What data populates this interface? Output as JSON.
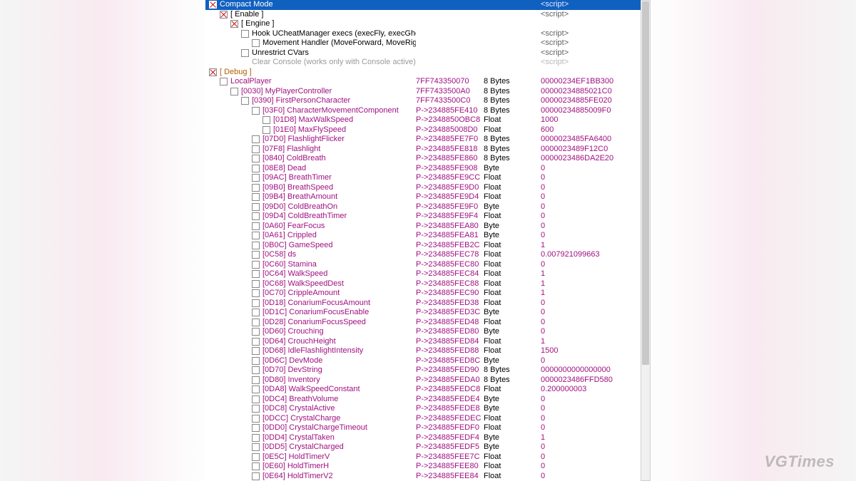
{
  "watermark": "VGTimes",
  "scriptTag": "<script>",
  "rows": [
    {
      "indent": 0,
      "checked": true,
      "header": true,
      "descClass": "",
      "label": "Compact Mode",
      "addr": "",
      "type": "",
      "val": "",
      "script": true
    },
    {
      "indent": 1,
      "checked": true,
      "descClass": "bracket",
      "label": "[ Enable ]",
      "addr": "",
      "type": "",
      "val": "",
      "script": true
    },
    {
      "indent": 2,
      "checked": true,
      "descClass": "bracket",
      "label": "[ Engine ]",
      "addr": "",
      "type": "",
      "val": ""
    },
    {
      "indent": 3,
      "checked": false,
      "descClass": "",
      "label": "Hook UCheatManager execs (execFly, execGhost, execWalk)",
      "addr": "",
      "type": "",
      "val": "",
      "script": true
    },
    {
      "indent": 4,
      "checked": false,
      "descClass": "",
      "label": "Movement Handler (MoveForward, MoveRight, MoveUp)",
      "addr": "",
      "type": "",
      "val": "",
      "script": true
    },
    {
      "indent": 3,
      "checked": false,
      "descClass": "",
      "label": "Unrestrict CVars",
      "addr": "",
      "type": "",
      "val": "",
      "script": true
    },
    {
      "indent": 3,
      "nobox": true,
      "descClass": "dim",
      "label": "Clear Console (works only with Console active)",
      "addr": "",
      "type": "",
      "val": "",
      "script": true,
      "scriptDim": true
    },
    {
      "indent": 0,
      "checked": true,
      "descClass": "debug",
      "label": "[ Debug ]",
      "addr": "",
      "type": "",
      "val": ""
    },
    {
      "indent": 1,
      "checked": false,
      "descClass": "purple",
      "label": "LocalPlayer",
      "addr": "7FF743350070",
      "type": "8 Bytes",
      "val": "00000234EF1BB300",
      "purple": true
    },
    {
      "indent": 2,
      "checked": false,
      "descClass": "purple",
      "label": "[0030] MyPlayerController",
      "addr": "7FF7433500A0",
      "type": "8 Bytes",
      "val": "00000234885021C0",
      "purple": true
    },
    {
      "indent": 3,
      "checked": false,
      "descClass": "purple",
      "label": "[0390] FirstPersonCharacter",
      "addr": "7FF7433500C0",
      "type": "8 Bytes",
      "val": "00000234885FE020",
      "purple": true
    },
    {
      "indent": 4,
      "checked": false,
      "descClass": "purple",
      "label": "[03F0] CharacterMovementComponent",
      "addr": "P->234885FE410",
      "type": "8 Bytes",
      "val": "00000234885009F0",
      "purple": true
    },
    {
      "indent": 5,
      "checked": false,
      "descClass": "purple",
      "label": "[01D8] MaxWalkSpeed",
      "addr": "P->2348850OBC8",
      "type": "Float",
      "val": "1000",
      "purple": true
    },
    {
      "indent": 5,
      "checked": false,
      "descClass": "purple",
      "label": "[01E0] MaxFlySpeed",
      "addr": "P->234885008D0",
      "type": "Float",
      "val": "600",
      "purple": true
    },
    {
      "indent": 4,
      "checked": false,
      "descClass": "purple",
      "label": "[07D0] FlashlightFlicker",
      "addr": "P->234885FE7F0",
      "type": "8 Bytes",
      "val": "0000023485FA6400",
      "purple": true
    },
    {
      "indent": 4,
      "checked": false,
      "descClass": "purple",
      "label": "[07F8] Flashlight",
      "addr": "P->234885FE818",
      "type": "8 Bytes",
      "val": "0000023489F12C0",
      "purple": true
    },
    {
      "indent": 4,
      "checked": false,
      "descClass": "purple",
      "label": "[0840] ColdBreath",
      "addr": "P->234885FE860",
      "type": "8 Bytes",
      "val": "0000023486DA2E20",
      "purple": true
    },
    {
      "indent": 4,
      "checked": false,
      "descClass": "purple",
      "label": "[08E8] Dead",
      "addr": "P->234885FE908",
      "type": "Byte",
      "val": "0",
      "purple": true
    },
    {
      "indent": 4,
      "checked": false,
      "descClass": "purple",
      "label": "[09AC] BreathTimer",
      "addr": "P->234885FE9CC",
      "type": "Float",
      "val": "0",
      "purple": true
    },
    {
      "indent": 4,
      "checked": false,
      "descClass": "purple",
      "label": "[09B0] BreathSpeed",
      "addr": "P->234885FE9D0",
      "type": "Float",
      "val": "0",
      "purple": true
    },
    {
      "indent": 4,
      "checked": false,
      "descClass": "purple",
      "label": "[09B4] BreathAmount",
      "addr": "P->234885FE9D4",
      "type": "Float",
      "val": "0",
      "purple": true
    },
    {
      "indent": 4,
      "checked": false,
      "descClass": "purple",
      "label": "[09D0] ColdBreathOn",
      "addr": "P->234885FE9F0",
      "type": "Byte",
      "val": "0",
      "purple": true
    },
    {
      "indent": 4,
      "checked": false,
      "descClass": "purple",
      "label": "[09D4] ColdBreathTimer",
      "addr": "P->234885FE9F4",
      "type": "Float",
      "val": "0",
      "purple": true
    },
    {
      "indent": 4,
      "checked": false,
      "descClass": "purple",
      "label": "[0A60] FearFocus",
      "addr": "P->234885FEA80",
      "type": "Byte",
      "val": "0",
      "purple": true
    },
    {
      "indent": 4,
      "checked": false,
      "descClass": "purple",
      "label": "[0A61] Crippled",
      "addr": "P->234885FEA81",
      "type": "Byte",
      "val": "0",
      "purple": true
    },
    {
      "indent": 4,
      "checked": false,
      "descClass": "purple",
      "label": "[0B0C] GameSpeed",
      "addr": "P->234885FEB2C",
      "type": "Float",
      "val": "1",
      "purple": true
    },
    {
      "indent": 4,
      "checked": false,
      "descClass": "purple",
      "label": "[0C58] ds",
      "addr": "P->234885FEC78",
      "type": "Float",
      "val": "0.007921099663",
      "purple": true
    },
    {
      "indent": 4,
      "checked": false,
      "descClass": "purple",
      "label": "[0C60] Stamina",
      "addr": "P->234885FEC80",
      "type": "Float",
      "val": "0",
      "purple": true
    },
    {
      "indent": 4,
      "checked": false,
      "descClass": "purple",
      "label": "[0C64] WalkSpeed",
      "addr": "P->234885FEC84",
      "type": "Float",
      "val": "1",
      "purple": true
    },
    {
      "indent": 4,
      "checked": false,
      "descClass": "purple",
      "label": "[0C68] WalkSpeedDest",
      "addr": "P->234885FEC88",
      "type": "Float",
      "val": "1",
      "purple": true
    },
    {
      "indent": 4,
      "checked": false,
      "descClass": "purple",
      "label": "[0C70] CrippleAmount",
      "addr": "P->234885FEC90",
      "type": "Float",
      "val": "1",
      "purple": true
    },
    {
      "indent": 4,
      "checked": false,
      "descClass": "purple",
      "label": "[0D18] ConariumFocusAmount",
      "addr": "P->234885FED38",
      "type": "Float",
      "val": "0",
      "purple": true
    },
    {
      "indent": 4,
      "checked": false,
      "descClass": "purple",
      "label": "[0D1C] ConariumFocusEnable",
      "addr": "P->234885FED3C",
      "type": "Byte",
      "val": "0",
      "purple": true
    },
    {
      "indent": 4,
      "checked": false,
      "descClass": "purple",
      "label": "[0D28] ConariumFocusSpeed",
      "addr": "P->234885FED48",
      "type": "Float",
      "val": "0",
      "purple": true
    },
    {
      "indent": 4,
      "checked": false,
      "descClass": "purple",
      "label": "[0D60] Crouching",
      "addr": "P->234885FED80",
      "type": "Byte",
      "val": "0",
      "purple": true
    },
    {
      "indent": 4,
      "checked": false,
      "descClass": "purple",
      "label": "[0D64] CrouchHeight",
      "addr": "P->234885FED84",
      "type": "Float",
      "val": "1",
      "purple": true
    },
    {
      "indent": 4,
      "checked": false,
      "descClass": "purple",
      "label": "[0D68] IdleFlashlightIntensity",
      "addr": "P->234885FED88",
      "type": "Float",
      "val": "1500",
      "purple": true
    },
    {
      "indent": 4,
      "checked": false,
      "descClass": "purple",
      "label": "[0D6C] DevMode",
      "addr": "P->234885FED8C",
      "type": "Byte",
      "val": "0",
      "purple": true
    },
    {
      "indent": 4,
      "checked": false,
      "descClass": "purple",
      "label": "[0D70] DevString",
      "addr": "P->234885FED90",
      "type": "8 Bytes",
      "val": "0000000000000000",
      "purple": true
    },
    {
      "indent": 4,
      "checked": false,
      "descClass": "purple",
      "label": "[0D80] Inventory",
      "addr": "P->234885FEDA0",
      "type": "8 Bytes",
      "val": "0000023486FFD580",
      "purple": true
    },
    {
      "indent": 4,
      "checked": false,
      "descClass": "purple",
      "label": "[0DA8] WalkSpeedConstant",
      "addr": "P->234885FEDC8",
      "type": "Float",
      "val": "0.200000003",
      "purple": true
    },
    {
      "indent": 4,
      "checked": false,
      "descClass": "purple",
      "label": "[0DC4] BreathVolume",
      "addr": "P->234885FEDE4",
      "type": "Byte",
      "val": "0",
      "purple": true
    },
    {
      "indent": 4,
      "checked": false,
      "descClass": "purple",
      "label": "[0DC8] CrystalActive",
      "addr": "P->234885FEDE8",
      "type": "Byte",
      "val": "0",
      "purple": true
    },
    {
      "indent": 4,
      "checked": false,
      "descClass": "purple",
      "label": "[0DCC] CrystalCharge",
      "addr": "P->234885FEDEC",
      "type": "Float",
      "val": "0",
      "purple": true
    },
    {
      "indent": 4,
      "checked": false,
      "descClass": "purple",
      "label": "[0DD0] CrystalChargeTimeout",
      "addr": "P->234885FEDF0",
      "type": "Float",
      "val": "0",
      "purple": true
    },
    {
      "indent": 4,
      "checked": false,
      "descClass": "purple",
      "label": "[0DD4] CrystalTaken",
      "addr": "P->234885FEDF4",
      "type": "Byte",
      "val": "1",
      "purple": true
    },
    {
      "indent": 4,
      "checked": false,
      "descClass": "purple",
      "label": "[0DD5] CrystalCharged",
      "addr": "P->234885FEDF5",
      "type": "Byte",
      "val": "0",
      "purple": true
    },
    {
      "indent": 4,
      "checked": false,
      "descClass": "purple",
      "label": "[0E5C] HoldTimerV",
      "addr": "P->234885FEE7C",
      "type": "Float",
      "val": "0",
      "purple": true
    },
    {
      "indent": 4,
      "checked": false,
      "descClass": "purple",
      "label": "[0E60] HoldTimerH",
      "addr": "P->234885FEE80",
      "type": "Float",
      "val": "0",
      "purple": true
    },
    {
      "indent": 4,
      "checked": false,
      "descClass": "purple",
      "label": "[0E64] HoldTimerV2",
      "addr": "P->234885FEE84",
      "type": "Float",
      "val": "0",
      "purple": true
    }
  ]
}
